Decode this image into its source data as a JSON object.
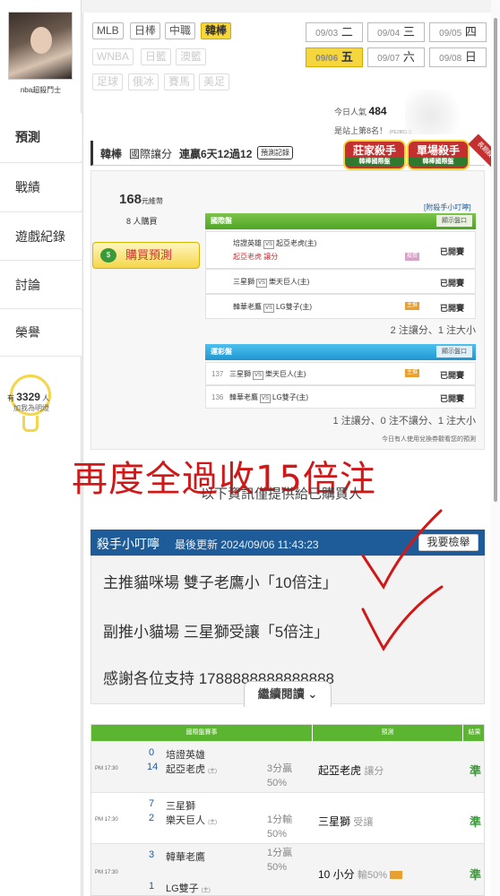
{
  "sidebar": {
    "username": "nba超殺鬥士",
    "nav": [
      "預測",
      "戰績",
      "遊戲紀錄",
      "討論",
      "榮譽"
    ],
    "fans_prefix": "有",
    "fans_count": "3329",
    "fans_suffix": "人",
    "fans_sub": "加我為明燈"
  },
  "leagues": {
    "row1": [
      "MLB",
      "日棒",
      "中職",
      "韓棒"
    ],
    "row2": [
      "WNBA",
      "日籃",
      "澳籃"
    ],
    "row3": [
      "足球",
      "俄冰",
      "賽馬",
      "美足"
    ],
    "active": "韓棒"
  },
  "dates": [
    {
      "md": "09/03",
      "wd": "二"
    },
    {
      "md": "09/04",
      "wd": "三"
    },
    {
      "md": "09/05",
      "wd": "四"
    },
    {
      "md": "09/06",
      "wd": "五"
    },
    {
      "md": "09/07",
      "wd": "六"
    },
    {
      "md": "09/08",
      "wd": "日"
    }
  ],
  "stats": {
    "pop_label": "今日人氣",
    "pop_value": "484",
    "rank_text": "是站上第8名！",
    "rank_small": "(PE2803.3)"
  },
  "title": {
    "league": "韓棒",
    "market": "國際讓分",
    "streak": "連贏6天12過12",
    "record_btn": "預測記錄"
  },
  "stamps": [
    {
      "top": "莊家殺手",
      "sub": "韓棒國際盤"
    },
    {
      "top": "單場殺手",
      "sub": "韓棒國際盤"
    }
  ],
  "ribbon": "長期殺手",
  "price": {
    "value": "168",
    "unit": "元維幣",
    "buyers": "8 人購買",
    "buy_label": "購買預測"
  },
  "attach_link": "[附殺手小叮嚀]",
  "intl": {
    "header": "國際盤",
    "tag": "顯示盤口",
    "rows": [
      {
        "match": "培證英雄",
        "opp": "起亞老虎(主)",
        "pick": "起亞老虎",
        "pick_type": "讓分",
        "status": "已開賽",
        "icon": "投資"
      },
      {
        "match": "三星獅",
        "opp": "樂天巨人(主)",
        "pick": "",
        "pick_type": "",
        "status": "已開賽",
        "icon": ""
      },
      {
        "match": "韓華老鷹",
        "opp": "LG雙子(主)",
        "pick": "",
        "pick_type": "",
        "status": "已開賽",
        "icon": "主推"
      }
    ],
    "summary": "2 注讓分、1 注大小"
  },
  "lottery": {
    "header": "運彩盤",
    "tag": "顯示盤口",
    "rows": [
      {
        "no": "137",
        "match": "三星獅",
        "opp": "樂天巨人(主)",
        "status": "已開賽",
        "icon": "主推"
      },
      {
        "no": "136",
        "match": "韓華老鷹",
        "opp": "LG雙子(主)",
        "status": "已開賽",
        "icon": ""
      }
    ],
    "summary": "1 注讓分、0 注不讓分、1 注大小",
    "note": "今日有人使用兌換券觀看您的預測"
  },
  "banner": "再度全過收15倍注",
  "paid_note": "以下資訊僅提供給已購買人",
  "killer": {
    "title": "殺手小叮嚀",
    "updated": "最後更新 2024/09/06 11:43:23",
    "report": "我要檢舉",
    "lines": [
      "主推貓咪場 雙子老鷹小「10倍注」",
      "副推小貓場 三星獅受讓「5倍注」",
      "感謝各位支持 1788888888888888"
    ],
    "more": "繼續閱讀"
  },
  "results": {
    "headers": [
      "國際盤賽事",
      "預測",
      "結果"
    ],
    "rows": [
      {
        "time": "PM 17:30",
        "s1": "0",
        "t1": "培證英雄",
        "s2": "14",
        "t2": "起亞老虎",
        "t2tag": "(主)",
        "hc1": "3分贏",
        "hc2": "50%",
        "pick": "起亞老虎",
        "ptype": "讓分",
        "result": "準"
      },
      {
        "time": "PM 17:30",
        "s1": "7",
        "t1": "三星獅",
        "s2": "2",
        "t2": "樂天巨人",
        "t2tag": "(主)",
        "hc1": "1分輸",
        "hc2": "50%",
        "pick": "三星獅",
        "ptype": "受讓",
        "result": "準"
      },
      {
        "time": "PM 17:30",
        "s1": "3",
        "t1": "韓華老鷹",
        "s2": "1",
        "t2": "LG雙子",
        "t2tag": "(主)",
        "hc1": "1分贏",
        "hc2": "50%",
        "pick": "10 小分",
        "ptype": "輸50%",
        "result": "準"
      }
    ]
  }
}
